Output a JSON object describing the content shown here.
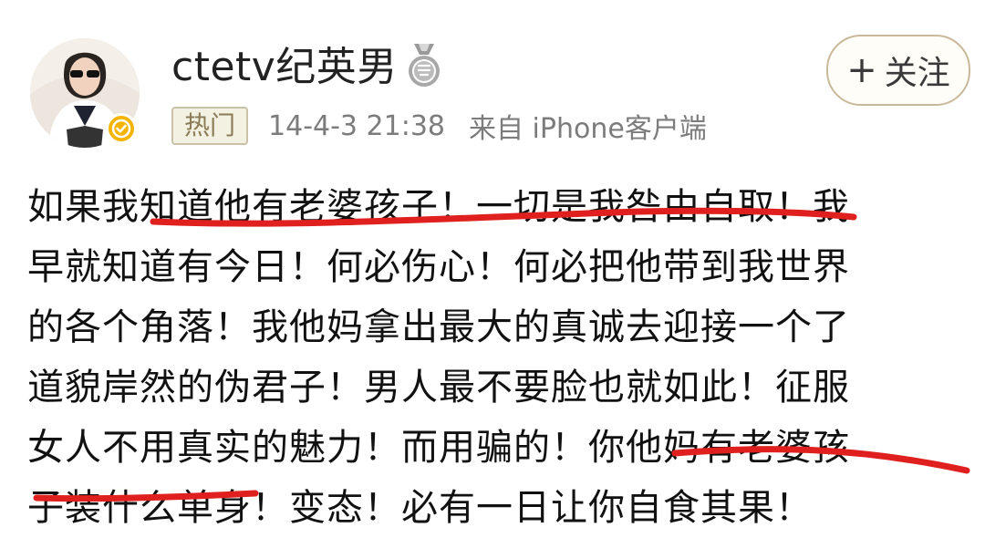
{
  "user": {
    "name": "ctetv纪英男",
    "medal_icon": "medal-icon",
    "verified_icon": "verified-badge-icon",
    "verified_color": "#f5b400"
  },
  "post_meta": {
    "hot_badge": "热门",
    "timestamp": "14-4-3 21:38",
    "source": "来自 iPhone客户端"
  },
  "follow_button": {
    "plus": "+",
    "label": "关注"
  },
  "post": {
    "lines": [
      "如果我知道他有老婆孩子！一切是我咎由自取！我",
      "早就知道有今日！何必伤心！何必把他带到我世界",
      "的各个角落！我他妈拿出最大的真诚去迎接一个了",
      "道貌岸然的伪君子！男人最不要脸也就如此！征服",
      "女人不用真实的魅力！而用骗的！你他妈有老婆孩",
      "子装什么单身！变态！必有一日让你自食其果！"
    ],
    "underline_color": "#e0201e"
  }
}
